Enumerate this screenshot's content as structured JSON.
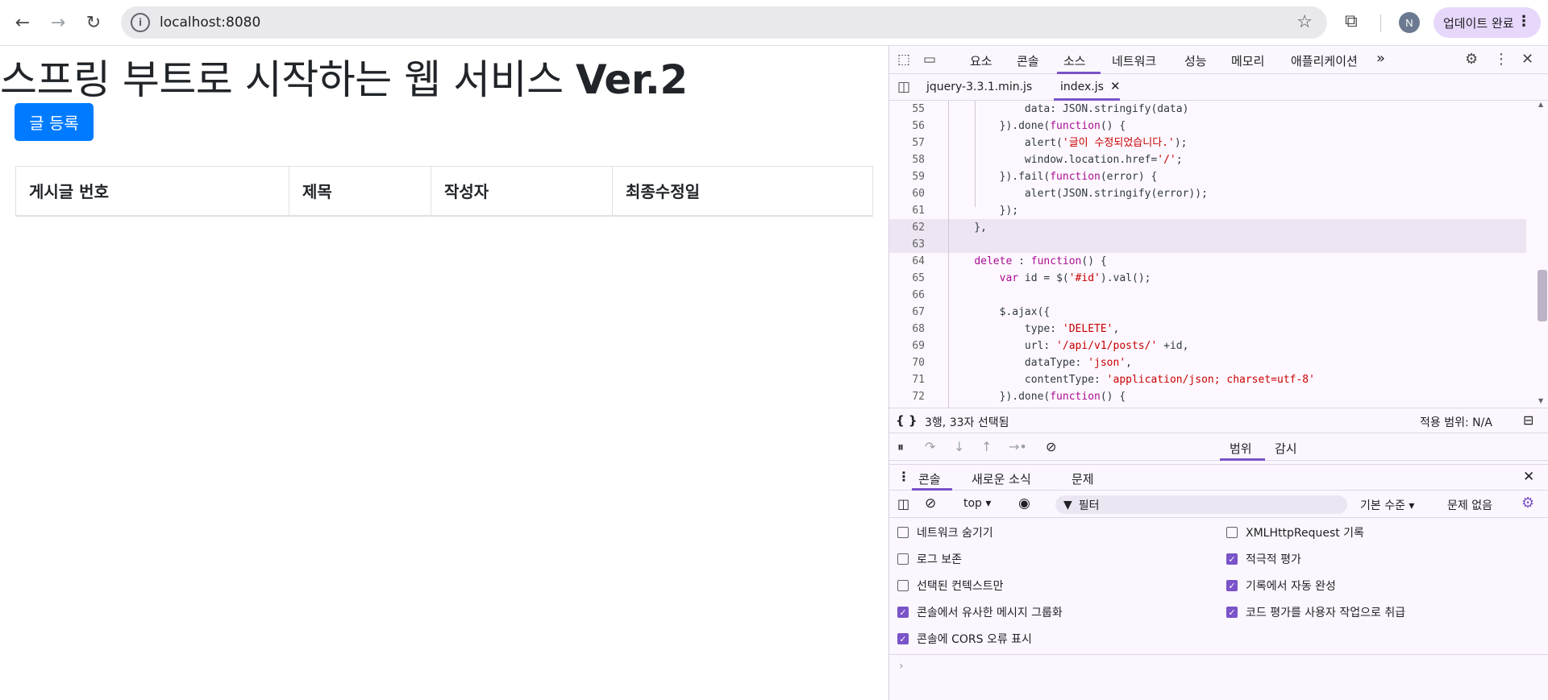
{
  "browser": {
    "url": "localhost:8080",
    "avatar_letter": "N",
    "update_label": "업데이트 완료"
  },
  "page": {
    "title_main": "스프링 부트로 시작하는 웹 서비스 ",
    "title_ver": "Ver.2",
    "register_button": "글 등록",
    "table_headers": [
      "게시글 번호",
      "제목",
      "작성자",
      "최종수정일"
    ]
  },
  "devtools": {
    "tabs": [
      "요소",
      "콘솔",
      "소스",
      "네트워크",
      "성능",
      "메모리",
      "애플리케이션"
    ],
    "active_tab": "소스",
    "more_tabs": "»",
    "files": [
      "jquery-3.3.1.min.js",
      "index.js"
    ],
    "active_file": "index.js",
    "code_lines": [
      {
        "n": "55",
        "text": "            data: JSON.stringify(data)"
      },
      {
        "n": "56",
        "text": "        }).done(function() {"
      },
      {
        "n": "57",
        "text": "            alert('글이 수정되었습니다.');"
      },
      {
        "n": "58",
        "text": "            window.location.href='/';"
      },
      {
        "n": "59",
        "text": "        }).fail(function(error) {"
      },
      {
        "n": "60",
        "text": "            alert(JSON.stringify(error));"
      },
      {
        "n": "61",
        "text": "        });"
      },
      {
        "n": "62",
        "text": "    },"
      },
      {
        "n": "63",
        "text": ""
      },
      {
        "n": "64",
        "text": "    delete : function() {"
      },
      {
        "n": "65",
        "text": "        var id = $('#id').val();"
      },
      {
        "n": "66",
        "text": ""
      },
      {
        "n": "67",
        "text": "        $.ajax({"
      },
      {
        "n": "68",
        "text": "            type: 'DELETE',"
      },
      {
        "n": "69",
        "text": "            url: '/api/v1/posts/' +id,"
      },
      {
        "n": "70",
        "text": "            dataType: 'json',"
      },
      {
        "n": "71",
        "text": "            contentType: 'application/json; charset=utf-8'"
      },
      {
        "n": "72",
        "text": "        }).done(function() {"
      }
    ],
    "status_left": "3행, 33자 선택됨",
    "status_right": "적용 범위: N/A",
    "debug_tabs": [
      "범위",
      "감시"
    ],
    "drawer_tabs": [
      "콘솔",
      "새로운 소식",
      "문제"
    ],
    "console_context": "top ▾",
    "filter_placeholder": "필터",
    "log_level": "기본 수준 ▾",
    "issues": "문제 없음",
    "settings_left": [
      {
        "label": "네트워크 숨기기",
        "checked": false
      },
      {
        "label": "로그 보존",
        "checked": false
      },
      {
        "label": "선택된 컨텍스트만",
        "checked": false
      },
      {
        "label": "콘솔에서 유사한 메시지 그룹화",
        "checked": true
      },
      {
        "label": "콘솔에 CORS 오류 표시",
        "checked": true
      }
    ],
    "settings_right": [
      {
        "label": "XMLHttpRequest 기록",
        "checked": false
      },
      {
        "label": "적극적 평가",
        "checked": true
      },
      {
        "label": "기록에서 자동 완성",
        "checked": true
      },
      {
        "label": "코드 평가를 사용자 작업으로 취급",
        "checked": true
      }
    ],
    "prompt": "›"
  }
}
